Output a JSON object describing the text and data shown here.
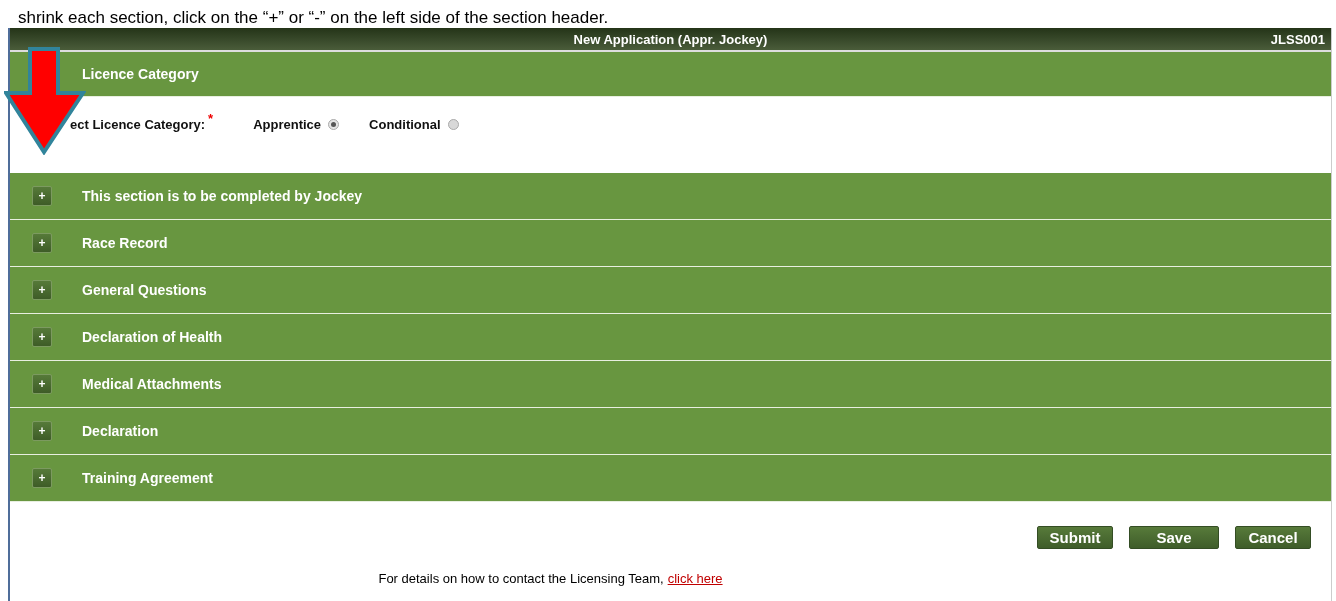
{
  "caption": "shrink each section, click on the “+” or “-” on the left side of the section header.",
  "window": {
    "title": "New Application (Appr. Jockey)",
    "code": "JLSS001"
  },
  "licence_category": {
    "header": "Licence Category",
    "label": "ect Licence Category:",
    "required_mark": "*",
    "options": [
      {
        "label": "Apprentice",
        "selected": true
      },
      {
        "label": "Conditional",
        "selected": false
      }
    ]
  },
  "sections": [
    {
      "toggle": "+",
      "title": "This section is to be completed by Jockey"
    },
    {
      "toggle": "+",
      "title": "Race Record"
    },
    {
      "toggle": "+",
      "title": "General Questions"
    },
    {
      "toggle": "+",
      "title": "Declaration of Health"
    },
    {
      "toggle": "+",
      "title": "Medical Attachments"
    },
    {
      "toggle": "+",
      "title": "Declaration"
    },
    {
      "toggle": "+",
      "title": "Training Agreement"
    }
  ],
  "buttons": [
    "Submit",
    "Save",
    "Cancel"
  ],
  "footer": {
    "text": "For details on how to contact the Licensing Team,",
    "link": "click here"
  }
}
